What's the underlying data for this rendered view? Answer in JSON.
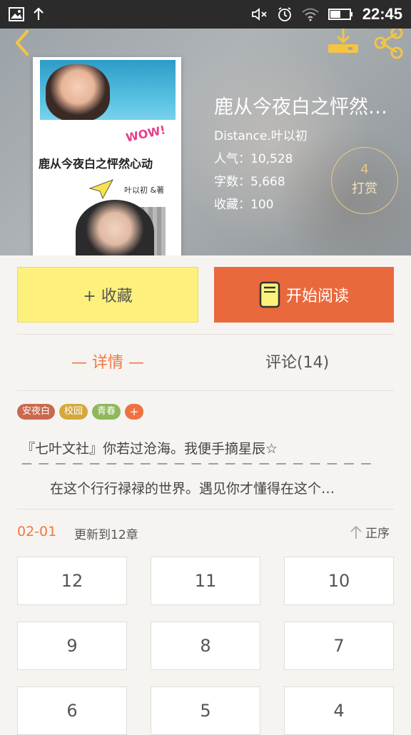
{
  "status_bar": {
    "time": "22:45"
  },
  "book": {
    "title": "鹿从今夜白之怦然…",
    "author": "Distance.叶以初",
    "popularity": "人气：10,528",
    "word_count": "字数：5,668",
    "favorites": "收藏：100"
  },
  "cover": {
    "title": "鹿从今夜白之怦然心动",
    "wow": "WOW!",
    "author": "叶以初 &著"
  },
  "tip": {
    "count": "4",
    "label": "打赏"
  },
  "actions": {
    "collect_label": "+ 收藏",
    "read_label": "开始阅读"
  },
  "tabs": {
    "detail": "— 详情 —",
    "comments": "评论(14)"
  },
  "tags": [
    {
      "label": "安夜白",
      "color": "#c9694f"
    },
    {
      "label": "校园",
      "color": "#d6a73a"
    },
    {
      "label": "青春",
      "color": "#8fb75b"
    },
    {
      "label": "+",
      "color": "#ee7142"
    }
  ],
  "intro": {
    "line1": "『七叶文社』你若过沧海。我便手摘星辰☆",
    "dashes": "— — — — — — — — — — — — — — — — — — — — —",
    "line2": "在这个行行禄禄的世界。遇见你才懂得在这个…"
  },
  "update": {
    "date": "02-01",
    "text": "更新到12章",
    "sort_label": "正序"
  },
  "chapters": [
    "12",
    "11",
    "10",
    "9",
    "8",
    "7",
    "6",
    "5",
    "4"
  ],
  "colors": {
    "accent": "#ef7842",
    "collect_bg": "#fdf17c",
    "read_bg": "#e9693d"
  }
}
